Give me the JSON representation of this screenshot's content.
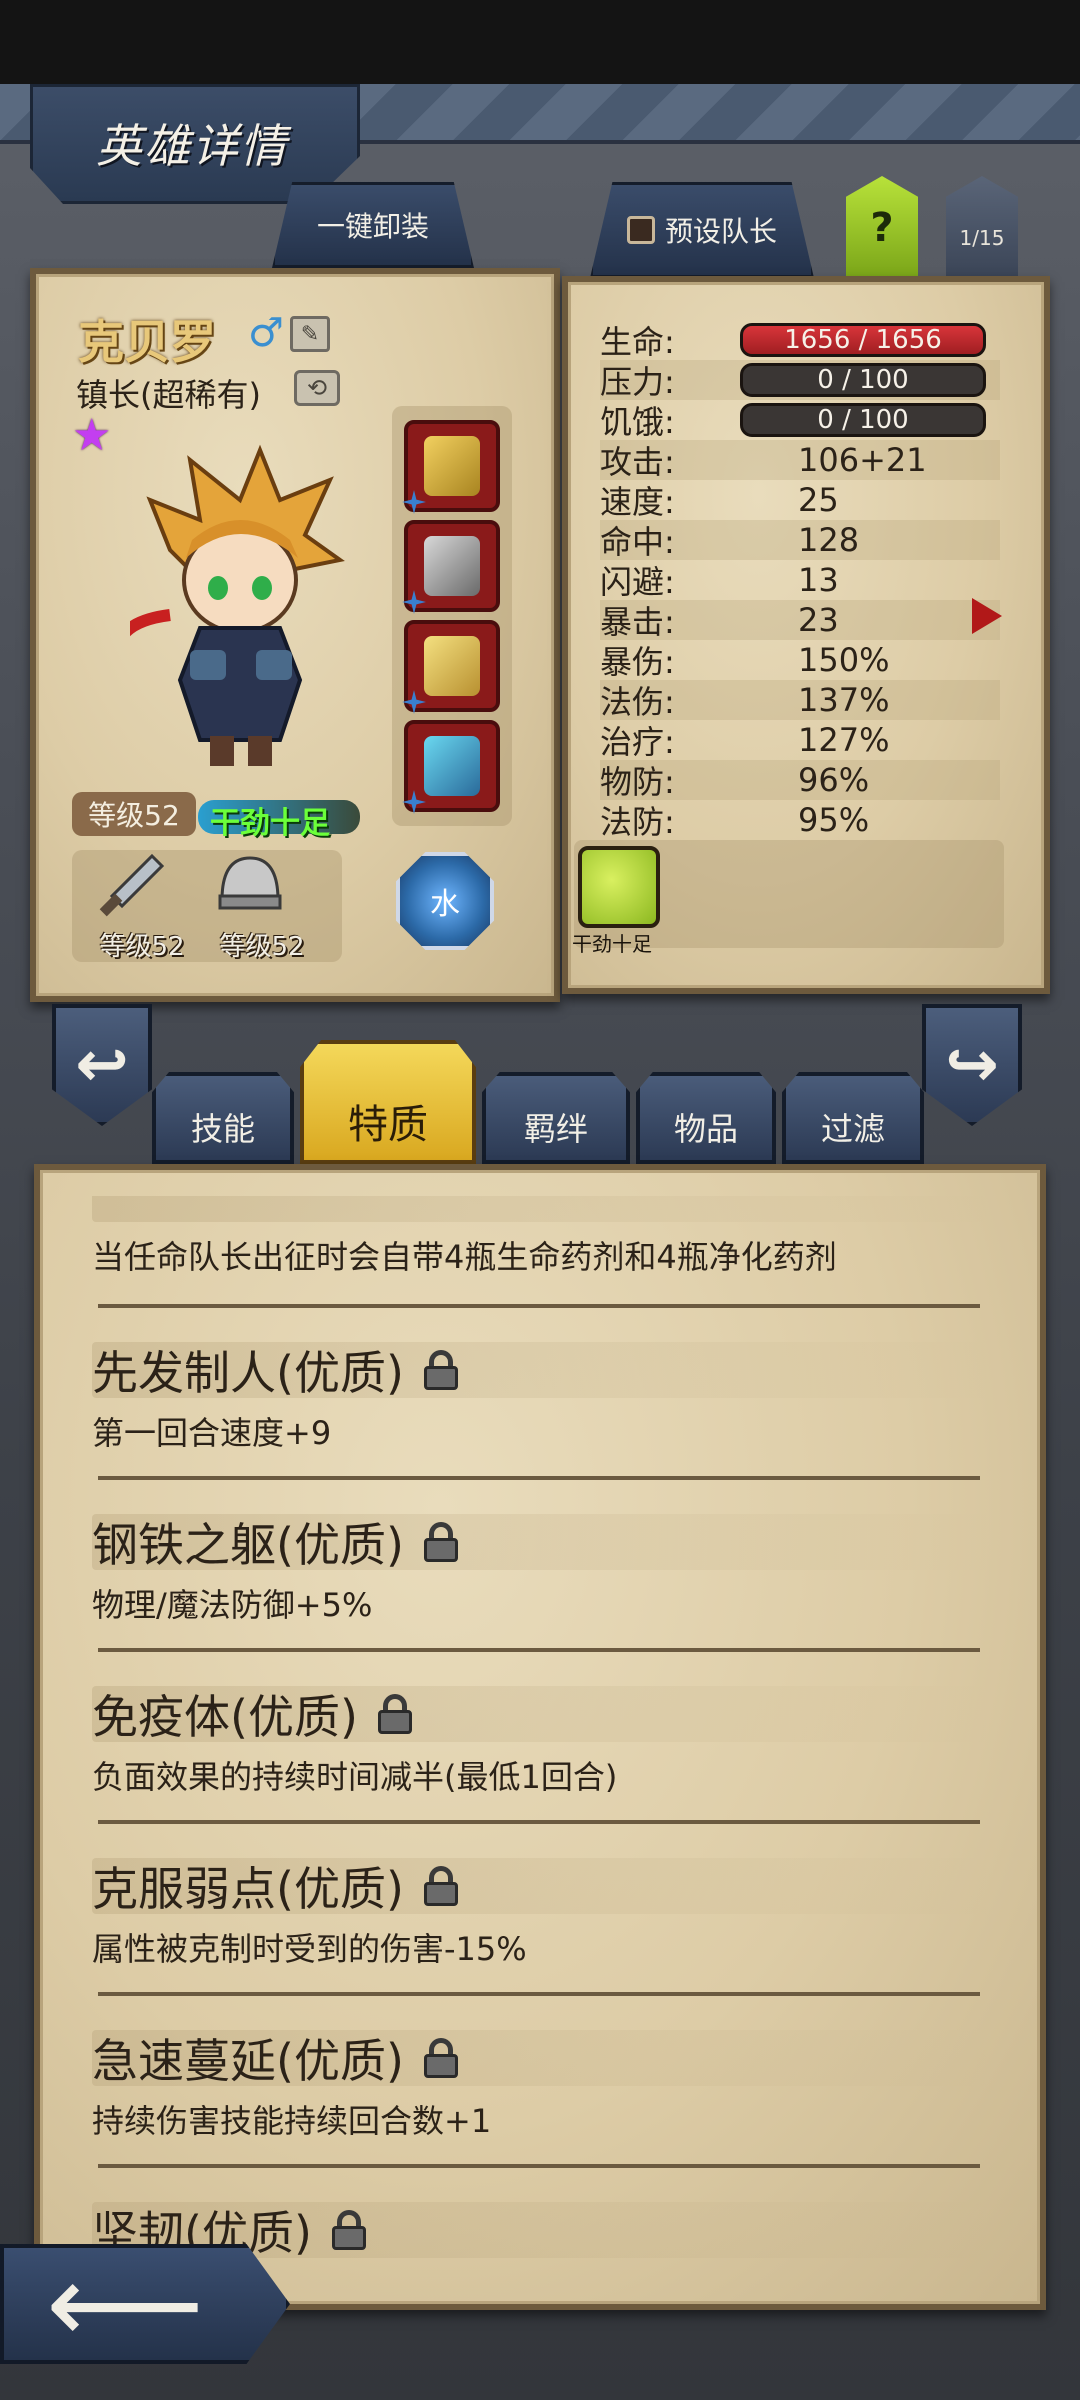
{
  "header": {
    "title": "英雄详情"
  },
  "top_buttons": {
    "unequip_all": "一键卸装",
    "preset_leader": "预设队长",
    "help": "?",
    "page_counter": "1/15"
  },
  "hero": {
    "name": "克贝罗",
    "gender_icon": "male-symbol-icon",
    "title": "镇长(超稀有)",
    "rarity_stars": 1,
    "level": "等级52",
    "status_tag": "干劲十足",
    "weapon_level": "等级52",
    "armor_level": "等级52",
    "element": "水"
  },
  "stats": [
    {
      "label": "生命:",
      "value": "1656 / 1656",
      "type": "bar",
      "color": "#c42a2e"
    },
    {
      "label": "压力:",
      "value": "0 / 100",
      "type": "bar",
      "color": "#3a3634"
    },
    {
      "label": "饥饿:",
      "value": "0 / 100",
      "type": "bar",
      "color": "#3a3634"
    },
    {
      "label": "攻击:",
      "value": "106+21"
    },
    {
      "label": "速度:",
      "value": "25"
    },
    {
      "label": "命中:",
      "value": "128"
    },
    {
      "label": "闪避:",
      "value": "13"
    },
    {
      "label": "暴击:",
      "value": "23"
    },
    {
      "label": "暴伤:",
      "value": "150%"
    },
    {
      "label": "法伤:",
      "value": "137%"
    },
    {
      "label": "治疗:",
      "value": "127%"
    },
    {
      "label": "物防:",
      "value": "96%"
    },
    {
      "label": "法防:",
      "value": "95%"
    }
  ],
  "trait_badge": {
    "label": "干劲十足"
  },
  "tabs": [
    {
      "label": "技能"
    },
    {
      "label": "特质"
    },
    {
      "label": "羁绊"
    },
    {
      "label": "物品"
    },
    {
      "label": "过滤"
    }
  ],
  "traits": [
    {
      "name": "",
      "desc": "当任命队长出征时会自带4瓶生命药剂和4瓶净化药剂"
    },
    {
      "name": "先发制人(优质)",
      "desc": "第一回合速度+9"
    },
    {
      "name": "钢铁之躯(优质)",
      "desc": "物理/魔法防御+5%"
    },
    {
      "name": "免疫体(优质)",
      "desc": "负面效果的持续时间减半(最低1回合)"
    },
    {
      "name": "克服弱点(优质)",
      "desc": "属性被克制时受到的伤害-15%"
    },
    {
      "name": "急速蔓延(优质)",
      "desc": "持续伤害技能持续回合数+1"
    },
    {
      "name": "坚韧(优质)",
      "desc": ""
    }
  ],
  "colors": {
    "parchment": "#e2d3b2",
    "navy": "#2c3a54",
    "active_tab": "#e9c23a",
    "hp_red": "#c42a2e"
  }
}
